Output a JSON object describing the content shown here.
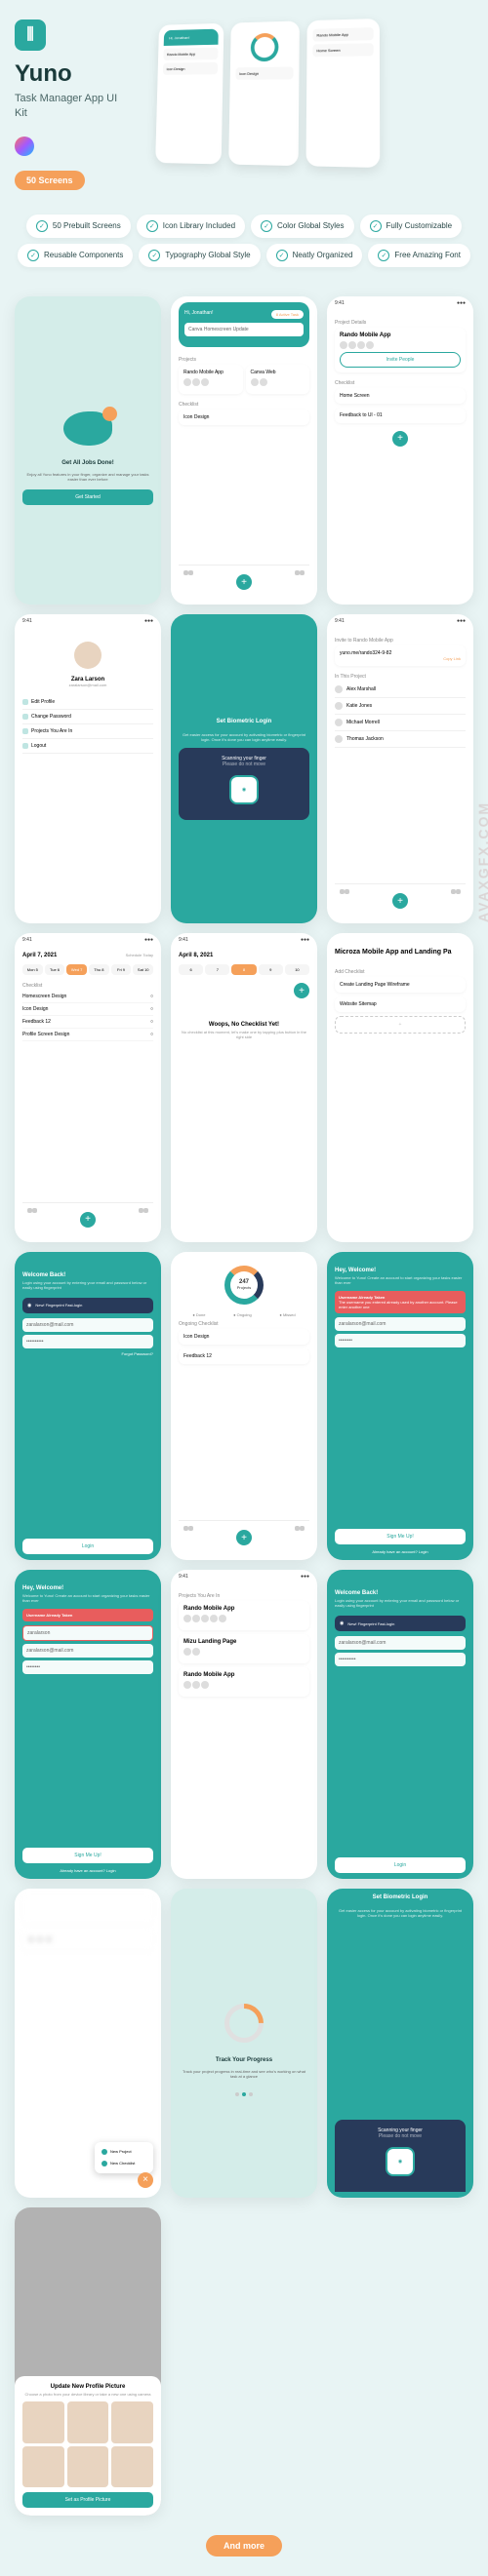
{
  "hero": {
    "logo": "⫼",
    "title": "Yuno",
    "subtitle": "Task Manager\nApp UI Kit",
    "screens_badge": "50 Screens"
  },
  "features": [
    "50 Prebuilt Screens",
    "Icon Library Included",
    "Color Global Styles",
    "Fully Customizable",
    "Reusable Components",
    "Typography Global Style",
    "Neatly Organized",
    "Free Amazing Font"
  ],
  "screens": {
    "onboard": {
      "title": "Get All Jobs Done!",
      "desc": "Enjoy all Yuno features in your finger, organize and manage your tasks easier than ever before",
      "cta": "Get Started"
    },
    "home": {
      "greeting": "Hi, Jonathan!",
      "active_badge": "8 Active Task",
      "search": "Canva Homescreen Update",
      "section1": "Projects",
      "project": "Rando Mobile App",
      "project2": "Canva Web",
      "section2": "Checklist",
      "task": "Icon Design"
    },
    "project_detail": {
      "header": "Project Details",
      "title": "Rando Mobile App",
      "invite": "Invite People",
      "section": "Checklist",
      "task1": "Home Screen",
      "task2": "Feedback to Ul - 01"
    },
    "profile": {
      "name": "Zara Larson",
      "email": "zaralarson@mail.com",
      "items": [
        "Edit Profile",
        "Change Password",
        "Projects You Are In",
        "Logout"
      ]
    },
    "biometric": {
      "title": "Set Biometric Login",
      "desc": "Get easier access for your account by activating biometric or fingerprint login. Once it's done you can login anytime easily.",
      "scanning": "Scanning your finger",
      "hint": "Please do not move"
    },
    "invite": {
      "time": "9:41",
      "title": "Invite to Rando Mobile App",
      "link": "yuno.me/rando324-9-82",
      "copy": "Copy Link",
      "section": "In This Project",
      "members": [
        "Alex Marshall",
        "Katie Jones",
        "Michael Morrell",
        "Thomas Jackson"
      ]
    },
    "calendar1": {
      "date": "April 7, 2021",
      "subtitle": "Schedule Today",
      "days": [
        "Mon 5",
        "Tue 6",
        "Wed 7",
        "Thu 8",
        "Fri 9",
        "Sat 10"
      ],
      "section": "Checklist",
      "tasks": [
        "Homescreen Design",
        "Icon Design",
        "Feedback 12",
        "Profile Screen Design"
      ]
    },
    "calendar2": {
      "date": "April 8, 2021",
      "empty_title": "Woops, No Checklist Yet!",
      "empty_desc": "No checklist at this moment, let's make one by tapping plus button in the right side"
    },
    "add_checklist": {
      "title": "Microza Mobile App and Landing Pa",
      "label": "Add Checklist",
      "task1": "Create Landing Page Wireframe",
      "task2": "Website Sitemap"
    },
    "login": {
      "title": "Welcome Back!",
      "desc": "Login using your account by entering your email and password below or easily using fingerprint",
      "fingerprint_label": "New! Fingerprint Fast-login",
      "email": "zaralarson@mail.com",
      "password": "••••••••••",
      "forgot": "Forgot Password?",
      "cta": "Login"
    },
    "stats": {
      "count": "247",
      "label": "Projects",
      "legend": [
        "Done",
        "Ongoing",
        "Missed"
      ],
      "section": "Ongoing Checklist",
      "task1": "Icon Design",
      "task2": "Feedback 12"
    },
    "signup": {
      "title": "Hey, Welcome!",
      "desc": "Welcome to Yuno! Create an account to start organizing your tasks easier than ever",
      "error": "Username Already Taken",
      "error_desc": "The username you entered already used by another account. Please enter another one",
      "email": "zaralarson@mail.com",
      "cta": "Sign Me Up!",
      "footer": "Already have an account? Login"
    },
    "projects_list": {
      "header": "Projects You Are In",
      "p1": "Rando Mobile App",
      "p2": "Mizu Landing Page",
      "p3": "Rando Mobile App"
    },
    "track": {
      "title": "Track Your Progress",
      "desc": "Track your project progress in real-time and see who's working on what task at a glance"
    },
    "update_photo": {
      "title": "Update New Profile Picture",
      "desc": "Choose a photo from your device library or take a new one using camera",
      "cta": "Set as Profile Picture"
    },
    "fab_menu": {
      "item1": "New Project",
      "item2": "New Checklist"
    }
  },
  "footer": {
    "and_more": "And more"
  },
  "watermark": "AVAXGFX.COM"
}
